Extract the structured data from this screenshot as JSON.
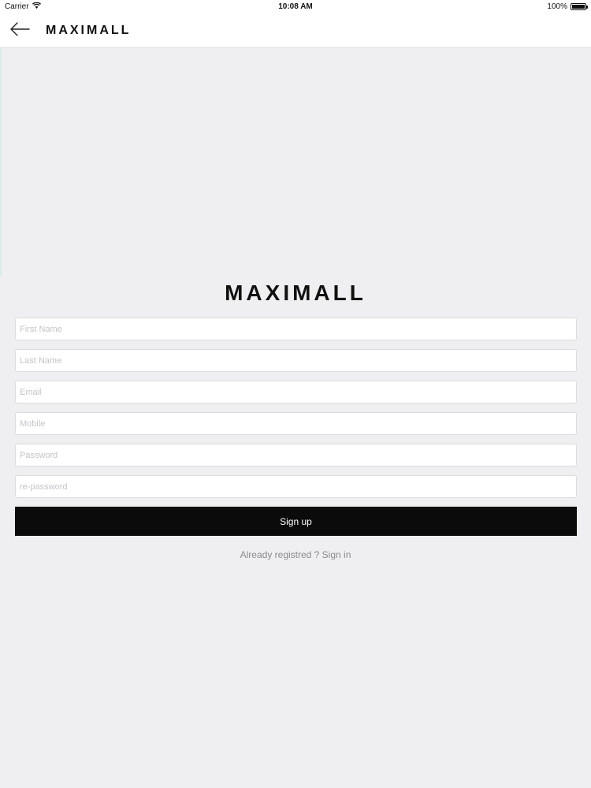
{
  "status_bar": {
    "carrier": "Carrier",
    "time": "10:08 AM",
    "battery": "100%",
    "battery_level": 1.0
  },
  "navbar": {
    "back_icon": "arrow-left-icon",
    "brand": "MAXIMALL"
  },
  "brand_logo": {
    "text": "MAXIMALL",
    "accent_color": "#e0524a"
  },
  "form": {
    "first_name_placeholder": "First Name",
    "last_name_placeholder": "Last Name",
    "email_placeholder": "Email",
    "mobile_placeholder": "Mobile",
    "password_placeholder": "Password",
    "repassword_placeholder": "re-password",
    "submit_label": "Sign up",
    "signin_text": "Already registred ? Sign in"
  },
  "colors": {
    "background": "#efeef0",
    "button": "#0b0b0c",
    "button_text": "#ffffff"
  }
}
